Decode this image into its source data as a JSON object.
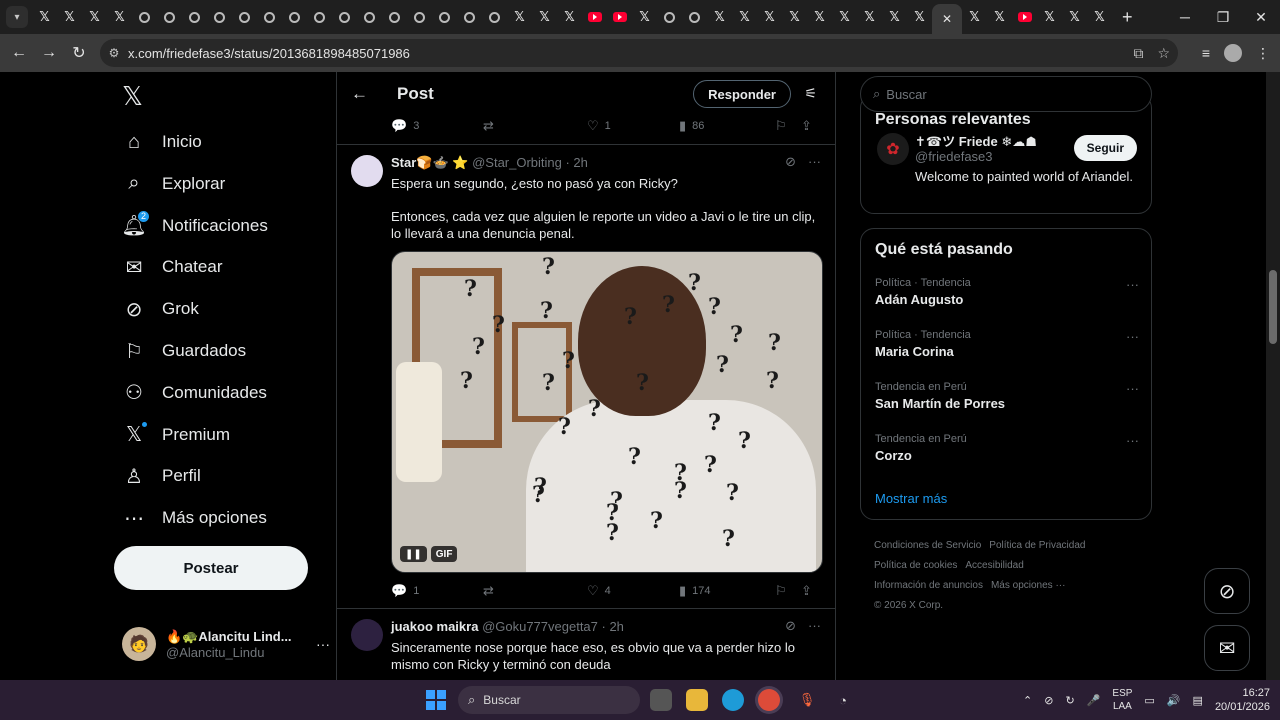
{
  "browser": {
    "url": "x.com/friedefase3/status/2013681898485071986",
    "tab_icons": [
      "x",
      "x",
      "x",
      "x",
      "chrome",
      "chrome",
      "chrome",
      "chrome",
      "chrome",
      "chrome",
      "chrome",
      "chrome",
      "chrome",
      "chrome",
      "chrome",
      "chrome",
      "chrome",
      "chrome",
      "chrome",
      "x",
      "x",
      "x",
      "yt",
      "yt",
      "x",
      "chrome",
      "chrome",
      "x",
      "x",
      "x",
      "x",
      "x",
      "x",
      "x",
      "x",
      "x",
      "active",
      "x",
      "x",
      "yt",
      "x",
      "x",
      "x"
    ],
    "new_tab_label": "+"
  },
  "nav": {
    "items": [
      {
        "label": "Inicio",
        "icon": "home-icon"
      },
      {
        "label": "Explorar",
        "icon": "search-icon"
      },
      {
        "label": "Notificaciones",
        "icon": "bell-icon",
        "badge": "2"
      },
      {
        "label": "Chatear",
        "icon": "mail-icon"
      },
      {
        "label": "Grok",
        "icon": "grok-icon"
      },
      {
        "label": "Guardados",
        "icon": "bookmark-icon"
      },
      {
        "label": "Comunidades",
        "icon": "communities-icon"
      },
      {
        "label": "Premium",
        "icon": "x-premium-icon"
      },
      {
        "label": "Perfil",
        "icon": "person-icon"
      },
      {
        "label": "Más opciones",
        "icon": "more-circle-icon"
      }
    ],
    "post_button": "Postear",
    "account": {
      "name": "🔥🐢Alancitu Lind...",
      "handle": "@Alancitu_Lindu"
    }
  },
  "header": {
    "title": "Post",
    "reply_button": "Responder"
  },
  "top_actions": {
    "replies": "3",
    "reposts": "",
    "likes": "1",
    "views": "86"
  },
  "tweets": [
    {
      "name": "Star🍞🍲 ⭐",
      "handle": "@Star_Orbiting · 2h",
      "text1": "Espera un segundo, ¿esto no pasó ya con Ricky?",
      "text2": "Entonces, cada vez que alguien le reporte un video a Javi o le tire un clip, lo llevará a una denuncia penal.",
      "gif_label": "GIF",
      "replies": "1",
      "reposts": "",
      "likes": "4",
      "views": "174"
    },
    {
      "name": "juakoo maikra",
      "handle": "@Goku777vegetta7 · 2h",
      "text1": "Sinceramente nose porque hace eso, es obvio que va a perder hizo lo mismo con Ricky y terminó con deuda"
    }
  ],
  "right": {
    "search_placeholder": "Buscar",
    "relevant_title": "Personas relevantes",
    "relevant_person": {
      "name": "✝☎ツ Friede ❄☁☗",
      "handle": "@friedefase3",
      "bio": "Welcome to painted world of Ariandel.",
      "follow": "Seguir"
    },
    "trends_title": "Qué está pasando",
    "trends": [
      {
        "category": "Política · Tendencia",
        "name": "Adán Augusto"
      },
      {
        "category": "Política · Tendencia",
        "name": "Maria Corina"
      },
      {
        "category": "Tendencia en Perú",
        "name": "San Martín de Porres"
      },
      {
        "category": "Tendencia en Perú",
        "name": "Corzo"
      }
    ],
    "show_more": "Mostrar más",
    "footer": [
      "Condiciones de Servicio",
      "Política de Privacidad",
      "Política de cookies",
      "Accesibilidad",
      "Información de anuncios",
      "Más opciones ···",
      "© 2026 X Corp."
    ]
  },
  "taskbar": {
    "search": "Buscar",
    "lang_top": "ESP",
    "lang_bottom": "LAA",
    "time": "16:27",
    "date": "20/01/2026"
  },
  "colors": {
    "accent": "#1d9bf0",
    "background": "#000000",
    "border": "#2f3336",
    "muted": "#71767b"
  }
}
